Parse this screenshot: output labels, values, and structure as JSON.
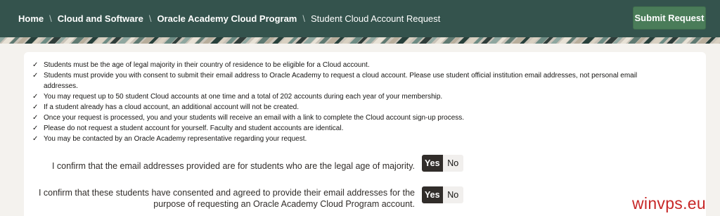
{
  "breadcrumb": [
    {
      "label": "Home",
      "current": false
    },
    {
      "label": "Cloud and Software",
      "current": false
    },
    {
      "label": "Oracle Academy Cloud Program",
      "current": false
    },
    {
      "label": "Student Cloud Account Request",
      "current": true
    }
  ],
  "separator": "\\",
  "submit_label": "Submit Request",
  "requirements": [
    "Students must be the age of legal majority in their country of residence to be eligible for a Cloud account.",
    "Students must provide you with consent to submit their email address to Oracle Academy to request a cloud account. Please use student official institution email addresses, not personal email addresses.",
    "You may request up to 50 student Cloud accounts at one time and a total of 202 accounts during each year of your membership.",
    "If a student already has a cloud account, an additional account will not be created.",
    "Once your request is processed, you and your students will receive an email with a link to complete the Cloud account sign-up process.",
    "Please do not request a student account for yourself. Faculty and student accounts are identical.",
    "You may be contacted by an Oracle Academy representative regarding your request."
  ],
  "check_glyph": "✓",
  "confirmations": [
    {
      "label": "I confirm that the email addresses provided are for students who are the legal age of majority.",
      "yes": "Yes",
      "no": "No",
      "selected": "Yes"
    },
    {
      "label": "I confirm that these students have consented and agreed to provide their email addresses for the purpose of requesting an Oracle Academy Cloud Program account.",
      "yes": "Yes",
      "no": "No",
      "selected": "Yes"
    }
  ],
  "watermark": "winvps.eu",
  "colors": {
    "header_bg": "#34534d",
    "submit_bg": "#4a7c59",
    "toggle_selected": "#312d2a",
    "watermark": "#c72727"
  }
}
